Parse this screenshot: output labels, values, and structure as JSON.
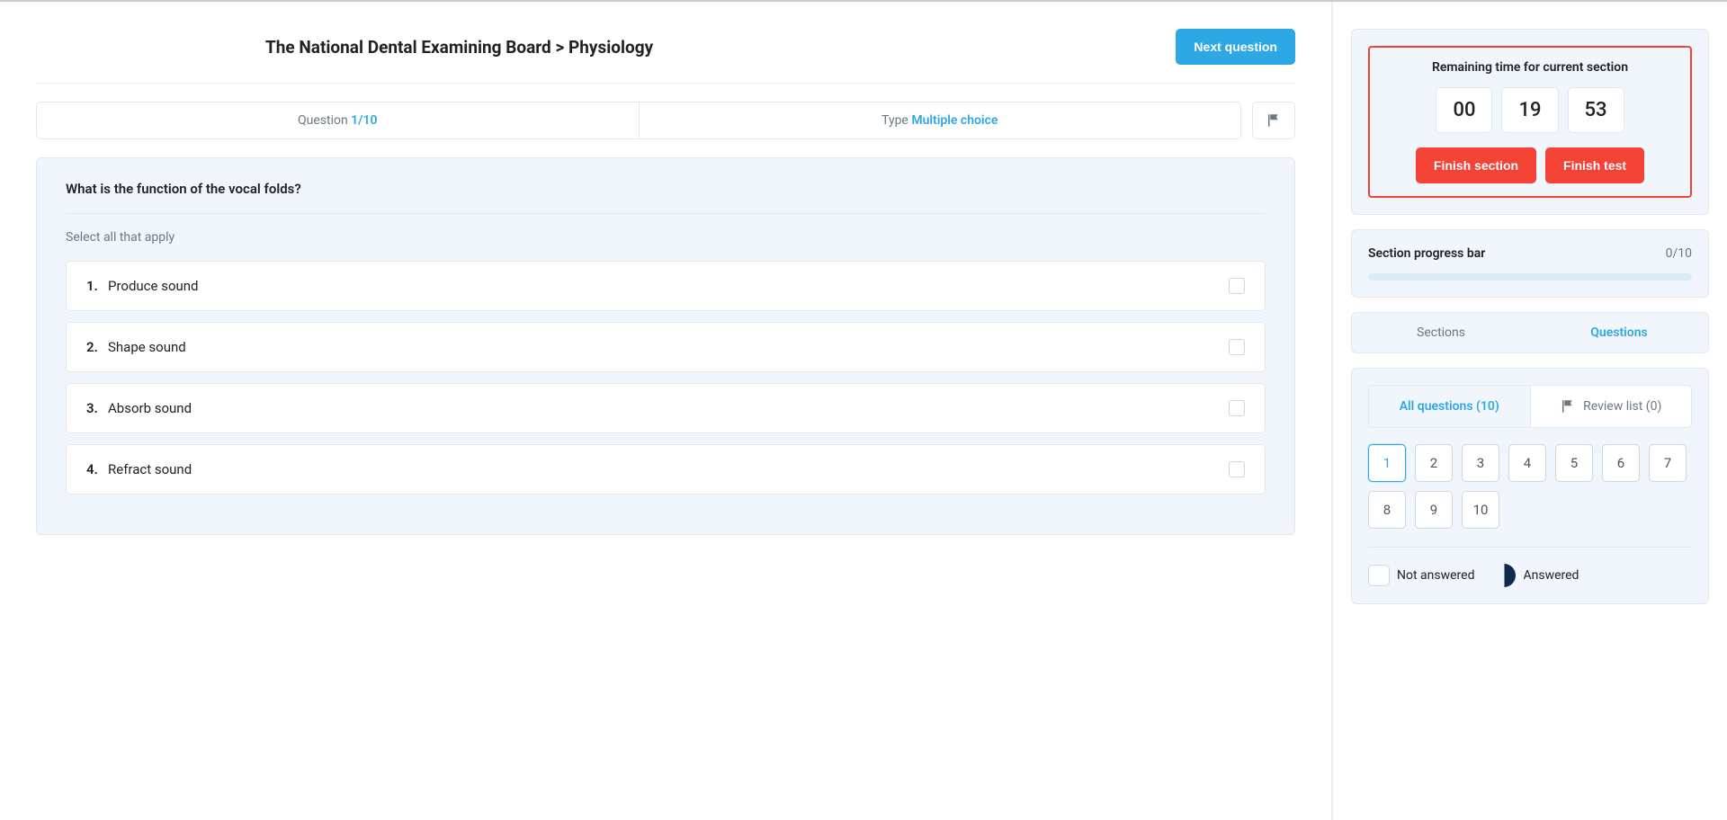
{
  "header": {
    "title": "The National Dental Examining Board > Physiology",
    "next_button": "Next question"
  },
  "info": {
    "question_label": "Question ",
    "question_count": "1/10",
    "type_label": "Type ",
    "type_value": "Multiple choice"
  },
  "question": {
    "text": "What is the function of the vocal folds?",
    "instruction": "Select all that apply",
    "options": [
      {
        "num": "1.",
        "text": "Produce sound"
      },
      {
        "num": "2.",
        "text": "Shape sound"
      },
      {
        "num": "3.",
        "text": "Absorb sound"
      },
      {
        "num": "4.",
        "text": "Refract sound"
      }
    ]
  },
  "timer": {
    "title": "Remaining time for current section",
    "hh": "00",
    "mm": "19",
    "ss": "53",
    "finish_section": "Finish section",
    "finish_test": "Finish test"
  },
  "progress": {
    "label": "Section progress bar",
    "count": "0/10"
  },
  "side_tabs": {
    "sections": "Sections",
    "questions": "Questions"
  },
  "subtabs": {
    "all": "All questions (10)",
    "review": "Review list (0)"
  },
  "qnumbers": [
    "1",
    "2",
    "3",
    "4",
    "5",
    "6",
    "7",
    "8",
    "9",
    "10"
  ],
  "legend": {
    "not_answered": "Not answered",
    "answered": "Answered"
  }
}
